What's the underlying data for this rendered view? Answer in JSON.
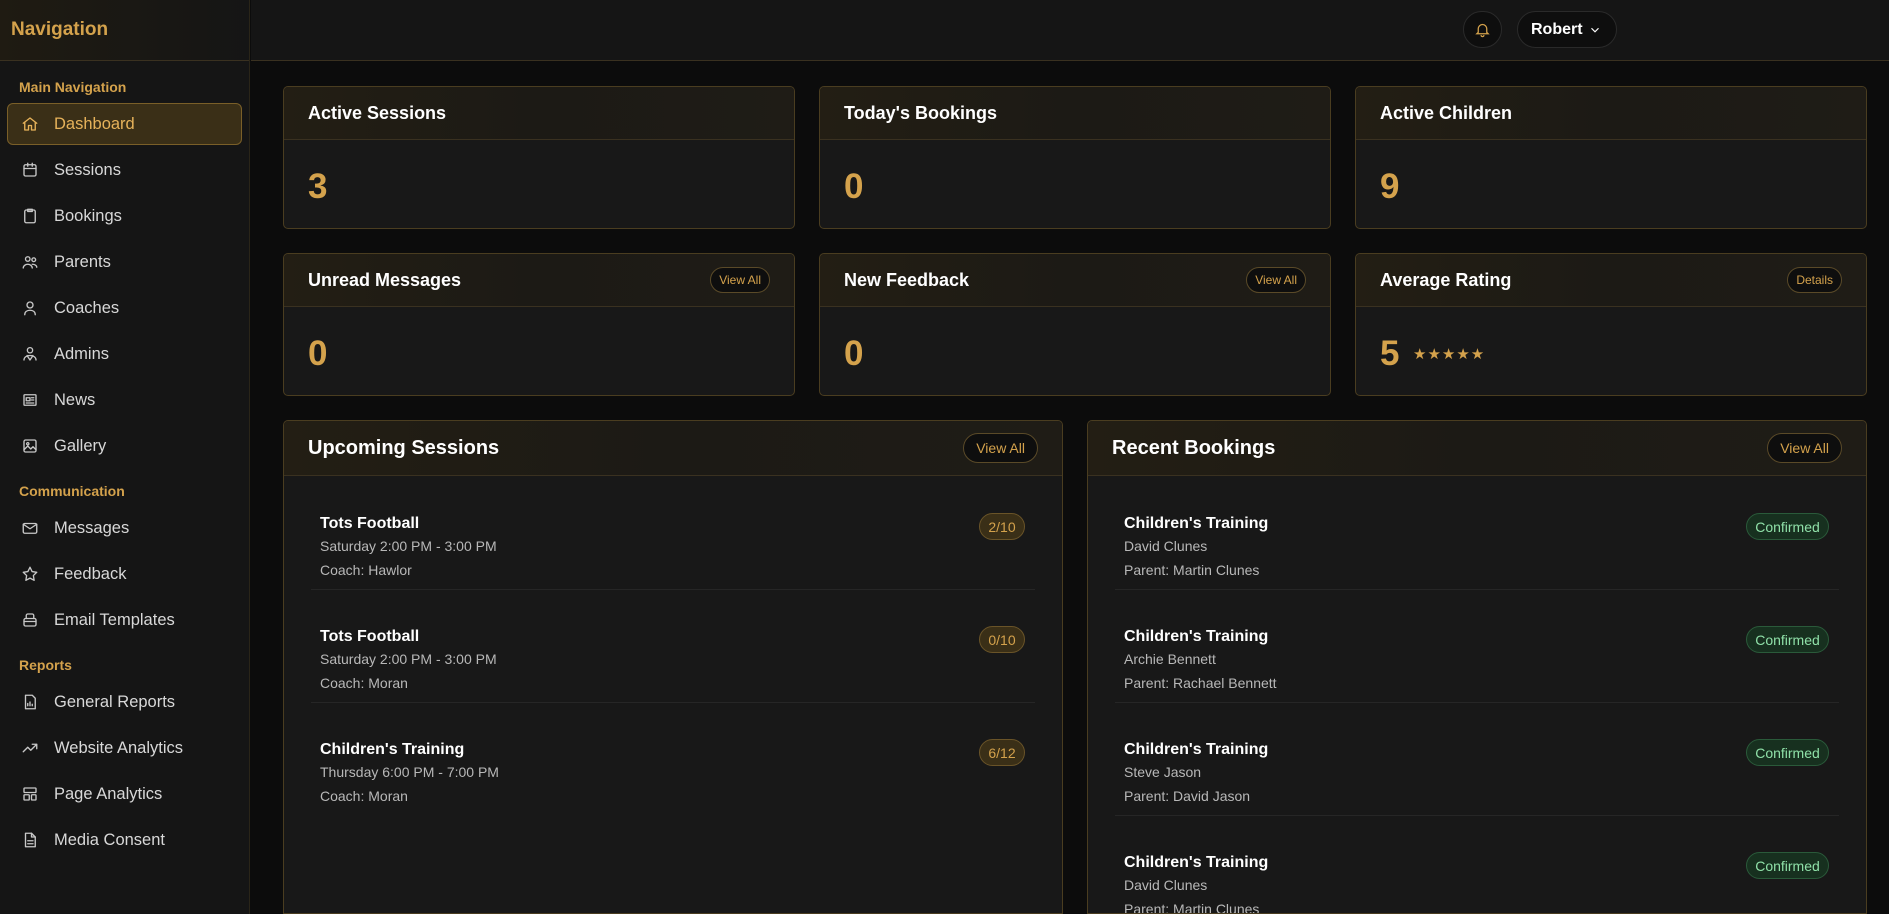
{
  "sidebar": {
    "title": "Navigation",
    "sections": [
      {
        "label": "Main Navigation",
        "items": [
          {
            "label": "Dashboard",
            "icon": "home-icon",
            "active": true
          },
          {
            "label": "Sessions",
            "icon": "calendar-icon"
          },
          {
            "label": "Bookings",
            "icon": "clipboard-icon"
          },
          {
            "label": "Parents",
            "icon": "users-icon"
          },
          {
            "label": "Coaches",
            "icon": "user-icon"
          },
          {
            "label": "Admins",
            "icon": "admins-icon"
          },
          {
            "label": "News",
            "icon": "newspaper-icon"
          },
          {
            "label": "Gallery",
            "icon": "image-icon"
          }
        ]
      },
      {
        "label": "Communication",
        "items": [
          {
            "label": "Messages",
            "icon": "mail-icon"
          },
          {
            "label": "Feedback",
            "icon": "star-icon"
          },
          {
            "label": "Email Templates",
            "icon": "template-icon"
          }
        ]
      },
      {
        "label": "Reports",
        "items": [
          {
            "label": "General Reports",
            "icon": "report-icon"
          },
          {
            "label": "Website Analytics",
            "icon": "trending-up-icon"
          },
          {
            "label": "Page Analytics",
            "icon": "layout-icon"
          },
          {
            "label": "Media Consent",
            "icon": "document-icon"
          }
        ]
      }
    ]
  },
  "topbar": {
    "user_name": "Robert"
  },
  "stats": [
    {
      "title": "Active Sessions",
      "value": "3"
    },
    {
      "title": "Today's Bookings",
      "value": "0"
    },
    {
      "title": "Active Children",
      "value": "9"
    },
    {
      "title": "Unread Messages",
      "value": "0",
      "action": "View All"
    },
    {
      "title": "New Feedback",
      "value": "0",
      "action": "View All"
    },
    {
      "title": "Average Rating",
      "value": "5",
      "action": "Details",
      "stars": "★★★★★"
    }
  ],
  "upcoming_sessions": {
    "title": "Upcoming Sessions",
    "action": "View All",
    "items": [
      {
        "title": "Tots Football",
        "time": "Saturday 2:00 PM - 3:00 PM",
        "coach": "Coach: Hawlor",
        "capacity": "2/10"
      },
      {
        "title": "Tots Football",
        "time": "Saturday 2:00 PM - 3:00 PM",
        "coach": "Coach: Moran",
        "capacity": "0/10"
      },
      {
        "title": "Children's Training",
        "time": "Thursday 6:00 PM - 7:00 PM",
        "coach": "Coach: Moran",
        "capacity": "6/12"
      }
    ]
  },
  "recent_bookings": {
    "title": "Recent Bookings",
    "action": "View All",
    "items": [
      {
        "title": "Children's Training",
        "child": "David Clunes",
        "parent": "Parent: Martin Clunes",
        "status": "Confirmed"
      },
      {
        "title": "Children's Training",
        "child": "Archie Bennett",
        "parent": "Parent: Rachael Bennett",
        "status": "Confirmed"
      },
      {
        "title": "Children's Training",
        "child": "Steve Jason",
        "parent": "Parent: David Jason",
        "status": "Confirmed"
      },
      {
        "title": "Children's Training",
        "child": "David Clunes",
        "parent": "Parent: Martin Clunes",
        "status": "Confirmed"
      }
    ]
  },
  "colors": {
    "accent": "#d4a24c",
    "background": "#0c0c0c",
    "card": "#181818",
    "confirmed": "#8fe0a8"
  }
}
